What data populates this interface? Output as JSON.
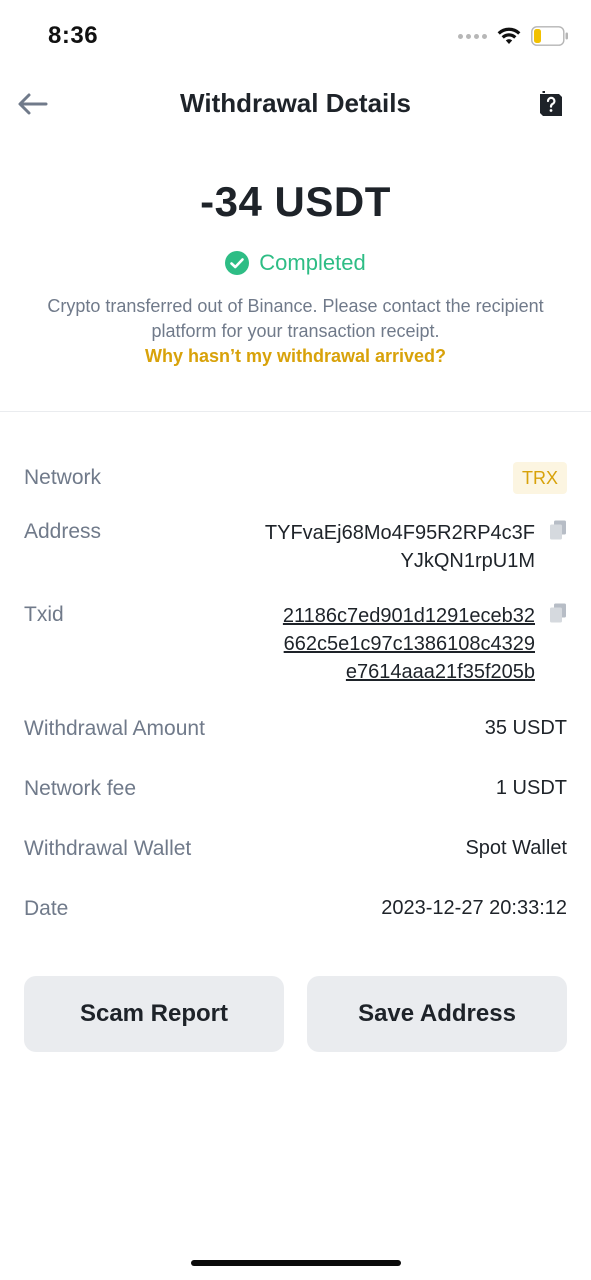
{
  "status_bar": {
    "time": "8:36"
  },
  "header": {
    "title": "Withdrawal Details"
  },
  "summary": {
    "amount": "-34 USDT",
    "status": "Completed",
    "info": "Crypto transferred out of Binance. Please contact the recipient platform for your transaction receipt.",
    "help_link": "Why hasn’t my withdrawal arrived?"
  },
  "details": {
    "network": {
      "label": "Network",
      "value": "TRX"
    },
    "address": {
      "label": "Address",
      "lines": [
        "TYFvaEj68Mo4F95R2RP4c3F",
        "YJkQN1rpU1M"
      ]
    },
    "txid": {
      "label": "Txid",
      "lines": [
        "21186c7ed901d1291eceb32",
        "662c5e1c97c1386108c4329",
        "e7614aaa21f35f205b"
      ]
    },
    "withdrawal_amount": {
      "label": "Withdrawal Amount",
      "value": "35 USDT"
    },
    "network_fee": {
      "label": "Network fee",
      "value": "1 USDT"
    },
    "withdrawal_wallet": {
      "label": "Withdrawal Wallet",
      "value": "Spot Wallet"
    },
    "date": {
      "label": "Date",
      "value": "2023-12-27 20:33:12"
    }
  },
  "actions": {
    "scam_report": "Scam Report",
    "save_address": "Save Address"
  },
  "colors": {
    "success": "#2ebd85",
    "accent": "#d8a20a",
    "muted": "#707a8a",
    "text": "#1e2329",
    "button_bg": "#eaecef"
  },
  "icons": [
    "wifi-icon",
    "battery-icon",
    "back-arrow-icon",
    "help-document-icon",
    "check-circle-icon",
    "copy-icon"
  ]
}
